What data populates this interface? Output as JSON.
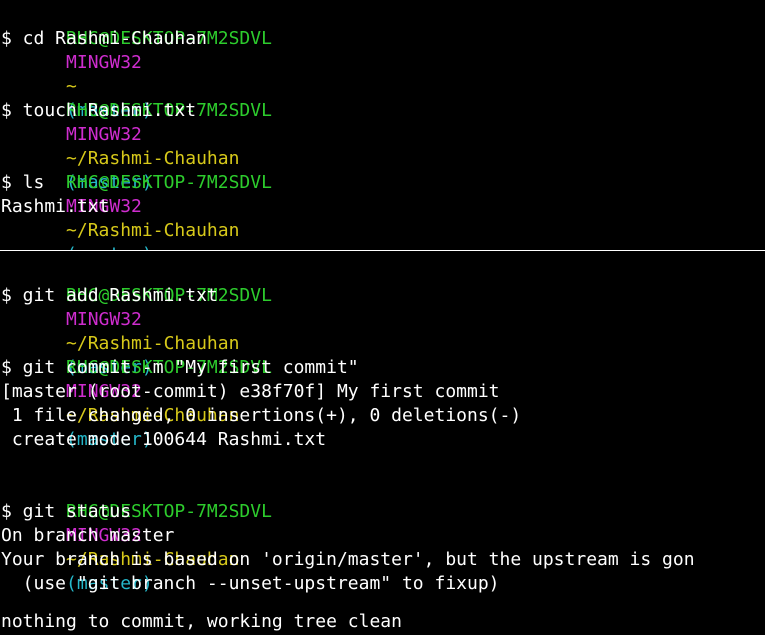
{
  "terminal": {
    "colors": {
      "background": "#000000",
      "user": "#2dcc2d",
      "system": "#cf2dcf",
      "path": "#d7c91a",
      "branch": "#25b7c9",
      "text": "#ffffff"
    },
    "prompt": {
      "user": "RHC@DESKTOP-7M2SDVL",
      "system": "MINGW32",
      "branch": "(master)",
      "path_home": "~",
      "path_repo": "~/Rashmi-Chauhan"
    },
    "entries": [
      {
        "command": "$ cd Rashmi-Chauhan",
        "output": []
      },
      {
        "command": "$ touch Rashmi.txt",
        "output": []
      },
      {
        "command": "$ ls",
        "output": [
          "Rashmi.txt"
        ]
      },
      {
        "command": "$ git add Rashmi.txt",
        "output": []
      },
      {
        "command": "$ git commit -m \"My first commit\"",
        "output": [
          "[master (root-commit) e38f70f] My first commit",
          " 1 file changed, 0 insertions(+), 0 deletions(-)",
          " create mode 100644 Rashmi.txt"
        ]
      },
      {
        "command": "$ git status",
        "output": [
          "On branch master",
          "Your branch is based on 'origin/master', but the upstream is gon",
          "  (use \"git branch --unset-upstream\" to fixup)",
          "",
          "nothing to commit, working tree clean"
        ]
      }
    ]
  }
}
